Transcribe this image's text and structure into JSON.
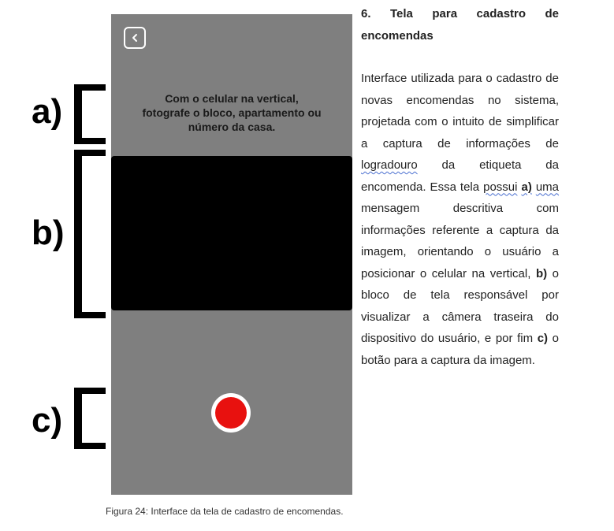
{
  "phone": {
    "instruction_lines": [
      "Com o celular na vertical,",
      "fotografe o bloco, apartamento ou",
      "número da casa."
    ],
    "capture_color": "#e8110f"
  },
  "labels": {
    "a": "a)",
    "b": "b)",
    "c": "c)"
  },
  "heading": {
    "number": "6.",
    "words": [
      "Tela",
      "para",
      "cadastro",
      "de"
    ],
    "line2": "encomendas"
  },
  "paragraph": {
    "p1": "Interface utilizada para o cadastro de novas encomendas no sistema, projetada com o intuito de simplificar a captura de informações de ",
    "w_logradouro": "logradouro",
    "p2": " da etiqueta da encomenda. Essa tela ",
    "w_possui": "possui",
    "p3": " ",
    "bold_a": "a)",
    "p4": " ",
    "w_uma": "uma",
    "p5": " mensagem descritiva com informações referente a captura da imagem, orientando o usuário a posicionar o celular na vertical, ",
    "bold_b": "b)",
    "p6": " o bloco de tela responsável por visualizar a câmera traseira do dispositivo do usuário, e por fim ",
    "bold_c": "c)",
    "p7": " o botão para a captura da imagem."
  },
  "caption": "Figura 24: Interface da tela de cadastro de encomendas."
}
